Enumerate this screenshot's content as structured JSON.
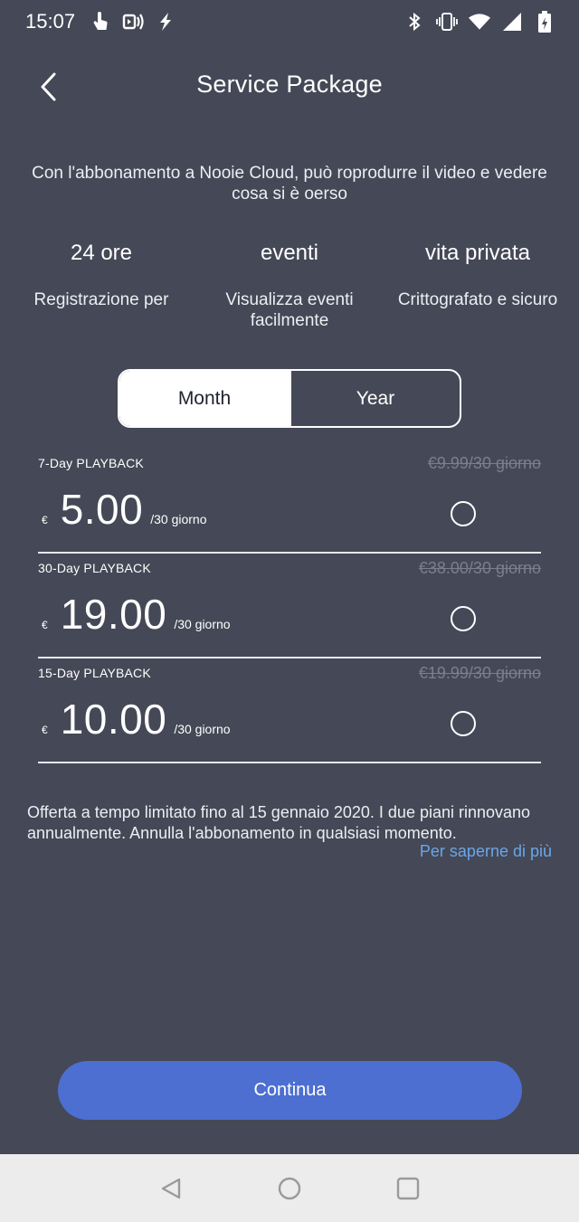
{
  "status_bar": {
    "time": "15:07",
    "left_icons": [
      "touch-icon",
      "nfc-icon",
      "flash-icon"
    ],
    "right_icons": [
      "bluetooth-icon",
      "vibrate-icon",
      "wifi-icon",
      "signal-icon",
      "battery-icon"
    ]
  },
  "header": {
    "title": "Service Package",
    "back_icon": "chevron-left-icon"
  },
  "intro": "Con l'abbonamento a Nooie Cloud, può roprodurre il video e vedere cosa si è oerso",
  "features": [
    {
      "title": "24 ore",
      "description": "Registrazione per"
    },
    {
      "title": "eventi",
      "description": "Visualizza eventi facilmente"
    },
    {
      "title": "vita privata",
      "description": "Crittografato e sicuro"
    }
  ],
  "toggle": {
    "month": "Month",
    "year": "Year",
    "selected": "Month"
  },
  "plans": [
    {
      "name": "7-Day PLAYBACK",
      "original_price": "€9.99/30 giorno",
      "currency": "€",
      "price": "5.00",
      "period": "/30 giorno",
      "selected": false
    },
    {
      "name": "30-Day PLAYBACK",
      "original_price": "€38.00/30 giorno",
      "currency": "€",
      "price": "19.00",
      "period": "/30 giorno",
      "selected": false
    },
    {
      "name": "15-Day PLAYBACK",
      "original_price": "€19.99/30 giorno",
      "currency": "€",
      "price": "10.00",
      "period": "/30 giorno",
      "selected": false
    }
  ],
  "offer_text": "Offerta a tempo limitato fino al 15 gennaio 2020. I due piani rinnovano annualmente. Annulla l'abbonamento in qualsiasi momento.",
  "learn_more": "Per saperne di più",
  "continue_label": "Continua",
  "colors": {
    "background": "#454856",
    "accent": "#4d6fd1",
    "link": "#6aa6e8",
    "strike": "#7b7f8d"
  }
}
